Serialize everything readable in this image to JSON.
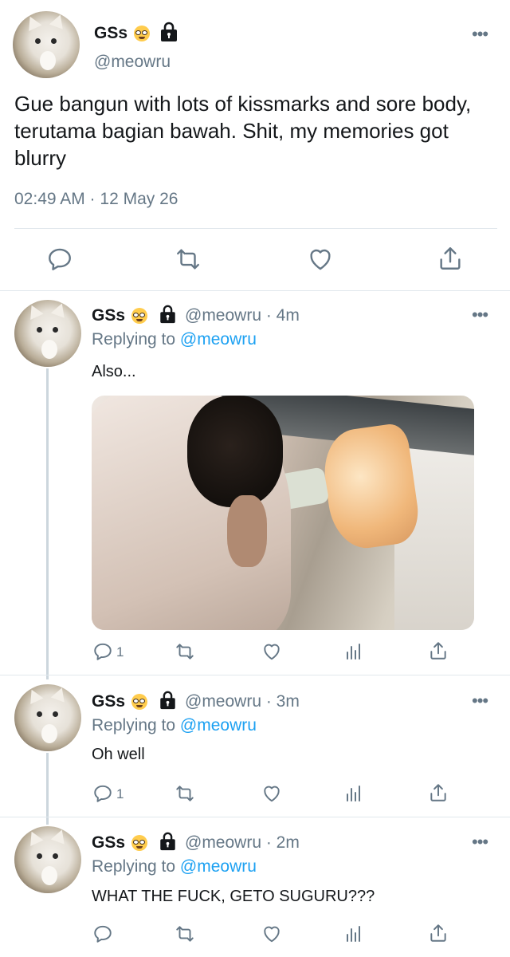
{
  "main_tweet": {
    "display_name": "GSs",
    "handle": "@meowru",
    "text": "Gue bangun with lots of kissmarks and sore body, terutama bagian bawah. Shit, my memories got blurry",
    "timestamp": "02:49 AM · 12 May 26",
    "more": "•••"
  },
  "replies": [
    {
      "display_name": "GSs",
      "handle_time": "@meowru · 4m",
      "replying_prefix": "Replying to ",
      "replying_to": "@meowru",
      "text": "Also...",
      "reply_count": "1",
      "has_media": true,
      "more": "•••"
    },
    {
      "display_name": "GSs",
      "handle_time": "@meowru · 3m",
      "replying_prefix": "Replying to ",
      "replying_to": "@meowru",
      "text": "Oh well",
      "reply_count": "1",
      "more": "•••"
    },
    {
      "display_name": "GSs",
      "handle_time": "@meowru · 2m",
      "replying_prefix": "Replying to ",
      "replying_to": "@meowru",
      "text": "WHAT THE FUCK, GETO SUGURU???",
      "reply_count": "",
      "more": "•••"
    }
  ],
  "icons": {
    "reply": "reply-icon",
    "retweet": "retweet-icon",
    "like": "like-icon",
    "analytics": "analytics-icon",
    "share": "share-icon",
    "lock": "lock-icon",
    "badge_emoji": "nerd-face-emoji"
  },
  "colors": {
    "text": "#14171a",
    "secondary": "#657786",
    "link": "#1da1f2",
    "divider": "#e1e8ed"
  }
}
